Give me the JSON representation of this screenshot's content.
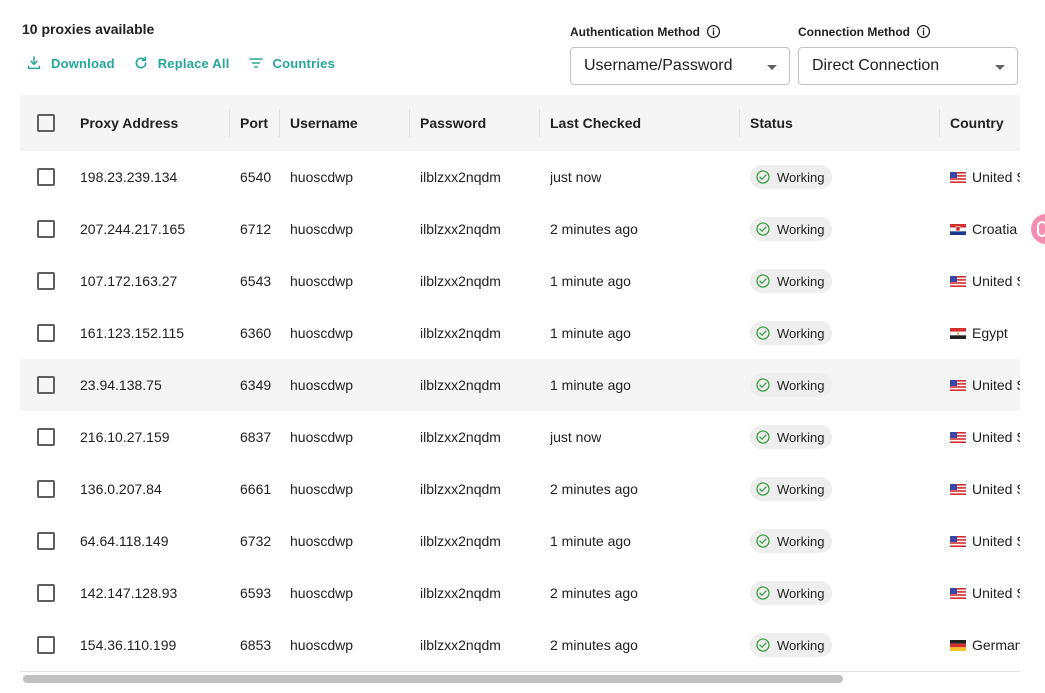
{
  "header": {
    "count_text": "10 proxies available",
    "actions": [
      {
        "label": "Download",
        "icon": "download-icon"
      },
      {
        "label": "Replace All",
        "icon": "refresh-icon"
      },
      {
        "label": "Countries",
        "icon": "filter-icon"
      }
    ]
  },
  "auth": {
    "label": "Authentication Method",
    "value": "Username/Password"
  },
  "connection": {
    "label": "Connection Method",
    "value": "Direct Connection"
  },
  "table": {
    "columns": [
      "Proxy Address",
      "Port",
      "Username",
      "Password",
      "Last Checked",
      "Status",
      "Country"
    ],
    "rows": [
      {
        "address": "198.23.239.134",
        "port": "6540",
        "username": "huoscdwp",
        "password": "ilblzxx2nqdm",
        "checked": "just now",
        "status": "Working",
        "country": "United States",
        "flag": "us"
      },
      {
        "address": "207.244.217.165",
        "port": "6712",
        "username": "huoscdwp",
        "password": "ilblzxx2nqdm",
        "checked": "2 minutes ago",
        "status": "Working",
        "country": "Croatia",
        "flag": "hr"
      },
      {
        "address": "107.172.163.27",
        "port": "6543",
        "username": "huoscdwp",
        "password": "ilblzxx2nqdm",
        "checked": "1 minute ago",
        "status": "Working",
        "country": "United States",
        "flag": "us"
      },
      {
        "address": "161.123.152.115",
        "port": "6360",
        "username": "huoscdwp",
        "password": "ilblzxx2nqdm",
        "checked": "1 minute ago",
        "status": "Working",
        "country": "Egypt",
        "flag": "eg"
      },
      {
        "address": "23.94.138.75",
        "port": "6349",
        "username": "huoscdwp",
        "password": "ilblzxx2nqdm",
        "checked": "1 minute ago",
        "status": "Working",
        "country": "United States",
        "flag": "us"
      },
      {
        "address": "216.10.27.159",
        "port": "6837",
        "username": "huoscdwp",
        "password": "ilblzxx2nqdm",
        "checked": "just now",
        "status": "Working",
        "country": "United States",
        "flag": "us"
      },
      {
        "address": "136.0.207.84",
        "port": "6661",
        "username": "huoscdwp",
        "password": "ilblzxx2nqdm",
        "checked": "2 minutes ago",
        "status": "Working",
        "country": "United States",
        "flag": "us"
      },
      {
        "address": "64.64.118.149",
        "port": "6732",
        "username": "huoscdwp",
        "password": "ilblzxx2nqdm",
        "checked": "1 minute ago",
        "status": "Working",
        "country": "United States",
        "flag": "us"
      },
      {
        "address": "142.147.128.93",
        "port": "6593",
        "username": "huoscdwp",
        "password": "ilblzxx2nqdm",
        "checked": "2 minutes ago",
        "status": "Working",
        "country": "United States",
        "flag": "us"
      },
      {
        "address": "154.36.110.199",
        "port": "6853",
        "username": "huoscdwp",
        "password": "ilblzxx2nqdm",
        "checked": "2 minutes ago",
        "status": "Working",
        "country": "Germany",
        "flag": "de"
      }
    ]
  },
  "colors": {
    "accent": "#26a69a",
    "status_check": "#43a047",
    "row_hover": "#f5f5f5"
  }
}
